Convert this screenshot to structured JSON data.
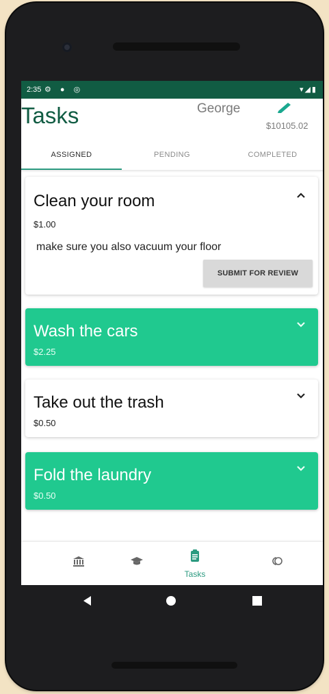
{
  "status_bar": {
    "time": "2:35",
    "left_icons": "⚙ ● ◎",
    "right_icons": "▾◢▮"
  },
  "header": {
    "title": "Tasks",
    "user_name": "George",
    "balance": "$10105.02",
    "edit_icon": "pencil-icon"
  },
  "tabs": [
    {
      "label": "ASSIGNED",
      "selected": true
    },
    {
      "label": "PENDING",
      "selected": false
    },
    {
      "label": "COMPLETED",
      "selected": false
    }
  ],
  "tasks": [
    {
      "title": "Clean your room",
      "price": "$1.00",
      "expanded": true,
      "description": "make sure you also vacuum your floor",
      "action": "SUBMIT FOR REVIEW",
      "color": "#ffffff"
    },
    {
      "title": "Wash the cars",
      "price": "$2.25",
      "expanded": false,
      "color": "#20c98f"
    },
    {
      "title": "Take out the trash",
      "price": "$0.50",
      "expanded": false,
      "color": "#ffffff"
    },
    {
      "title": "Fold the laundry",
      "price": "$0.50",
      "expanded": false,
      "color": "#20c98f"
    }
  ],
  "bottom_nav": [
    {
      "icon": "bank-icon",
      "label": ""
    },
    {
      "icon": "school-icon",
      "label": ""
    },
    {
      "icon": "clipboard-icon",
      "label": "Tasks",
      "selected": true
    },
    {
      "icon": "loans-icon",
      "label": ""
    }
  ],
  "colors": {
    "accent": "#115c43",
    "green": "#20c98f",
    "tab_indicator": "#2b9a80"
  }
}
